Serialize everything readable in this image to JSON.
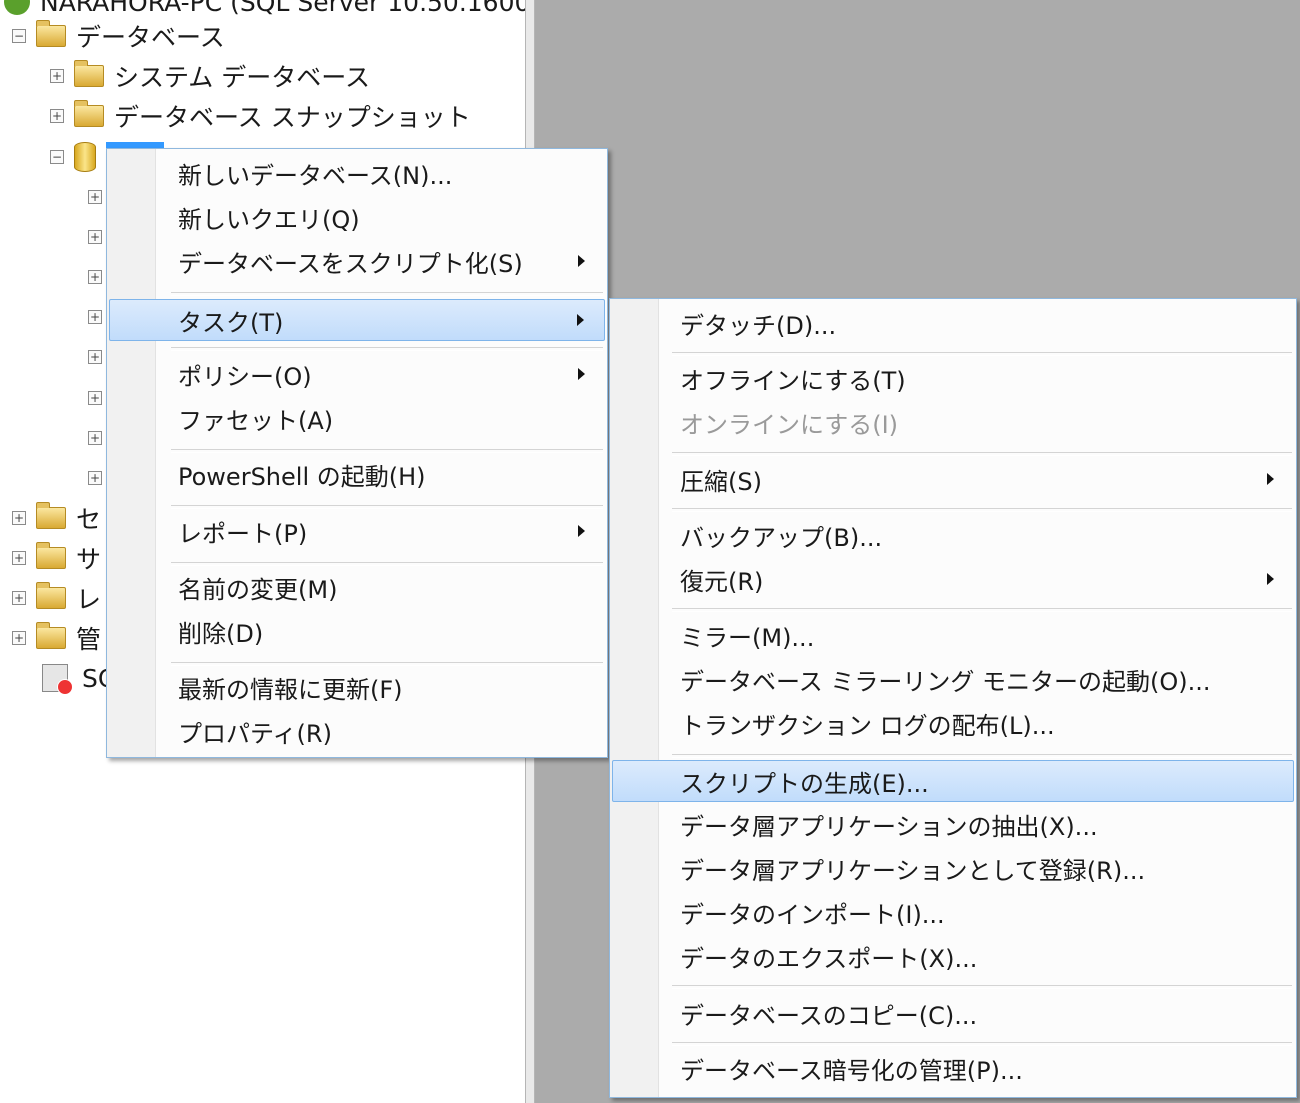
{
  "tree": {
    "server": "NARAHORA-PC (SQL Server 10.50.1600",
    "databases": "データベース",
    "system_databases": "システム データベース",
    "snapshots": "データベース スナップショット",
    "selected_db": "",
    "truncated": [
      "セ",
      "サ",
      "レ",
      "管",
      "SC"
    ]
  },
  "context_menu": {
    "items": [
      {
        "label": "新しいデータベース(N)..."
      },
      {
        "label": "新しいクエリ(Q)"
      },
      {
        "label": "データベースをスクリプト化(S)",
        "submenu": true
      },
      {
        "label": "タスク(T)",
        "submenu": true,
        "highlighted": true
      },
      {
        "label": "ポリシー(O)",
        "submenu": true
      },
      {
        "label": "ファセット(A)"
      },
      {
        "label": "PowerShell の起動(H)"
      },
      {
        "label": "レポート(P)",
        "submenu": true
      },
      {
        "label": "名前の変更(M)"
      },
      {
        "label": "削除(D)"
      },
      {
        "label": "最新の情報に更新(F)"
      },
      {
        "label": "プロパティ(R)"
      }
    ]
  },
  "tasks_submenu": {
    "items": [
      {
        "label": "デタッチ(D)..."
      },
      {
        "label": "オフラインにする(T)"
      },
      {
        "label": "オンラインにする(I)",
        "disabled": true
      },
      {
        "label": "圧縮(S)",
        "submenu": true
      },
      {
        "label": "バックアップ(B)..."
      },
      {
        "label": "復元(R)",
        "submenu": true
      },
      {
        "label": "ミラー(M)..."
      },
      {
        "label": "データベース ミラーリング モニターの起動(O)..."
      },
      {
        "label": "トランザクション ログの配布(L)..."
      },
      {
        "label": "スクリプトの生成(E)...",
        "highlighted": true
      },
      {
        "label": "データ層アプリケーションの抽出(X)..."
      },
      {
        "label": "データ層アプリケーションとして登録(R)..."
      },
      {
        "label": "データのインポート(I)..."
      },
      {
        "label": "データのエクスポート(X)..."
      },
      {
        "label": "データベースのコピー(C)..."
      },
      {
        "label": "データベース暗号化の管理(P)..."
      }
    ]
  },
  "colors": {
    "highlight": "#c1dcfb",
    "menu_border": "#8fb8de",
    "background": "#ababab"
  }
}
